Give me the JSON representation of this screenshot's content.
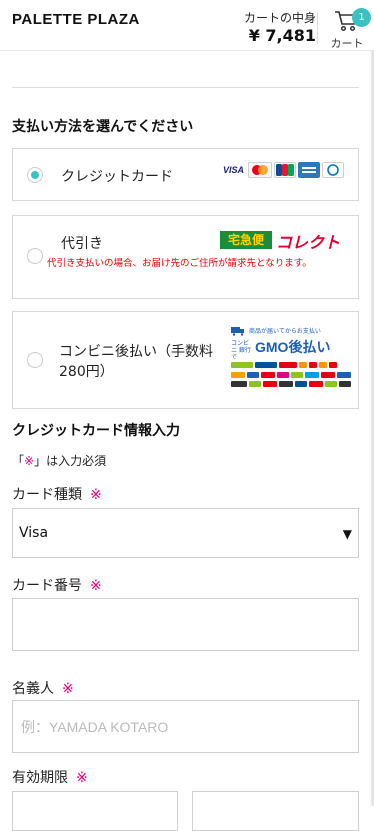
{
  "header": {
    "logo": "PALETTE PLAZA",
    "cart_label": "カートの中身",
    "cart_total": "¥ 7,481",
    "cart_button_label": "カート",
    "cart_count": "1"
  },
  "payment": {
    "title": "支払い方法を選んでください",
    "options": [
      {
        "label": "クレジットカード",
        "selected": true,
        "logos": [
          "VISA",
          "MasterCard",
          "JCB",
          "AMEX",
          "Diners Club"
        ]
      },
      {
        "label": "代引き",
        "selected": false,
        "note": "代引き支払いの場合、お届け先のご住所が請求先となります。",
        "logo_green": "宅急便",
        "logo_red": "コレクト"
      },
      {
        "label": "コンビニ後払い（手数料280円）",
        "selected": false,
        "gmo_banner": "商品が届いてからお支払い",
        "gmo_small": "コンビニ 銀行で",
        "gmo_title": "GMO後払い"
      }
    ]
  },
  "card_info": {
    "title": "クレジットカード情報入力",
    "required_note_prefix": "「",
    "required_mark": "※",
    "required_note_suffix": "」は入力必須",
    "card_type_label": "カード種類",
    "card_type_value": "Visa",
    "card_number_label": "カード番号",
    "card_number_value": "",
    "holder_label": "名義人",
    "holder_placeholder": "例：YAMADA KOTARO",
    "expiry_label": "有効期限"
  },
  "colors": {
    "accent": "#3cc1c2",
    "required": "#e4007f",
    "note": "#e00000"
  }
}
